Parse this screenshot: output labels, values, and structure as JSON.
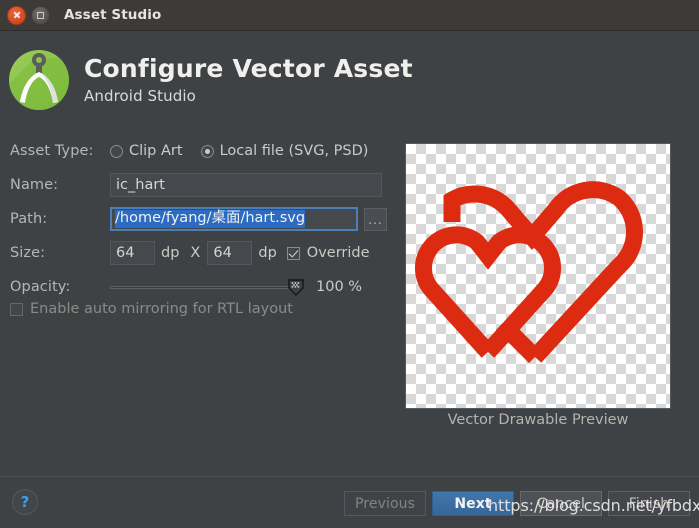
{
  "window": {
    "title": "Asset Studio",
    "close_icon": "close-icon",
    "maximize_icon": "maximize-icon"
  },
  "header": {
    "title": "Configure Vector Asset",
    "subtitle": "Android Studio",
    "logo_icon": "android-studio-logo-icon"
  },
  "form": {
    "asset_type": {
      "label": "Asset Type:",
      "options": [
        {
          "label": "Clip Art",
          "selected": false
        },
        {
          "label": "Local file (SVG, PSD)",
          "selected": true
        }
      ]
    },
    "name": {
      "label": "Name:",
      "value": "ic_hart"
    },
    "path": {
      "label": "Path:",
      "value": "/home/fyang/桌面/hart.svg",
      "browse_label": "...",
      "selected": true
    },
    "size": {
      "label": "Size:",
      "width": "64",
      "height": "64",
      "unit": "dp",
      "separator": "X",
      "override_label": "Override",
      "override_checked": true
    },
    "opacity": {
      "label": "Opacity:",
      "value": "100 %",
      "percent": 100
    },
    "rtl": {
      "label": "Enable auto mirroring for RTL layout",
      "checked": false
    }
  },
  "preview": {
    "caption": "Vector Drawable Preview",
    "icon_name": "two-hearts-outline-icon",
    "stroke_color": "#dd2b11"
  },
  "footer": {
    "help_label": "?",
    "buttons": [
      {
        "label": "Previous",
        "state": "disabled"
      },
      {
        "label": "Next",
        "state": "primary"
      },
      {
        "label": "Cancel",
        "state": "hover"
      },
      {
        "label": "Finish",
        "state": "normal"
      }
    ]
  },
  "watermark": {
    "text": "https://blog.csdn.net/yfbdxz"
  }
}
